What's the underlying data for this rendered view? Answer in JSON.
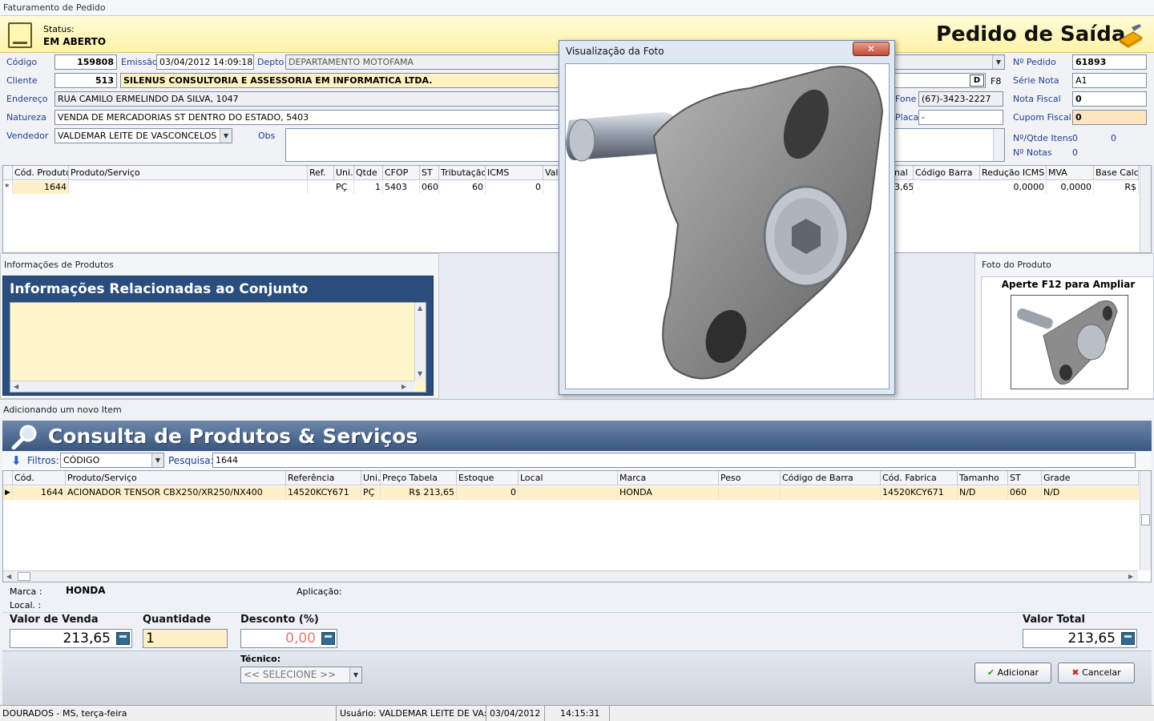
{
  "window": {
    "title": "Faturamento de Pedido"
  },
  "header": {
    "status_label": "Status:",
    "status_value": "EM ABERTO",
    "title": "Pedido de Saída"
  },
  "form": {
    "codigo_label": "Código",
    "codigo": "159808",
    "emissao_label": "Emissão",
    "emissao": "03/04/2012 14:09:18",
    "depto_label": "Depto",
    "depto": "DEPARTAMENTO MOTOFAMA",
    "cliente_label": "Cliente",
    "cliente_cod": "513",
    "cliente_nome": "SILENUS CONSULTORIA E ASSESSORIA EM INFORMATICA LTDA.",
    "endereco_label": "Endereço",
    "endereco": "RUA CAMILO ERMELINDO DA SILVA, 1047",
    "natureza_label": "Natureza",
    "natureza": "VENDA DE MERCADORIAS ST DENTRO  DO ESTADO, 5403",
    "vendedor_label": "Vendedor",
    "vendedor": "VALDEMAR LEITE DE VASCONCELOS",
    "obs_label": "Obs",
    "d_button": "D",
    "f8_label": "F8",
    "fone_label": "Fone",
    "fone": "(67)-3423-2227",
    "placa_label": "Placa",
    "placa": "-",
    "pedido_label": "Nº Pedido",
    "pedido": "61893",
    "serie_label": "Série Nota",
    "serie": "A1",
    "nota_label": "Nota Fiscal",
    "nota": "0",
    "cupom_label": "Cupom Fiscal",
    "cupom": "0",
    "qtde_label": "Nº/Qtde Itens",
    "qtde_a": "0",
    "qtde_b": "0",
    "notas_label": "Nº Notas",
    "notas": "0"
  },
  "grid1": {
    "headers": [
      "Cód. Produto",
      "Produto/Serviço",
      "Ref.",
      "Uni.",
      "Qtde",
      "CFOP",
      "ST",
      "Tributação",
      "ICMS",
      "Valo",
      "nal",
      "Código Barra",
      "Redução ICMS",
      "MVA",
      "Base Calcu"
    ],
    "row": {
      "marker": "*",
      "cod": "1644",
      "uni": "PÇ",
      "qtde": "1",
      "cfop": "5403",
      "st": "060",
      "trib": "60",
      "icms": "0",
      "nal": "3,65",
      "reducao": "0,0000",
      "mva": "0,0000",
      "base": "R$"
    }
  },
  "info_panel": {
    "title": "Informações de Produtos",
    "header": "Informações Relacionadas ao Conjunto"
  },
  "foto_panel": {
    "title": "Foto do Produto",
    "hint": "Aperte F12 para Ampliar"
  },
  "popup": {
    "title": "Visualização da Foto",
    "close": "✕"
  },
  "consulta": {
    "section_title": "Adicionando um novo Item",
    "title": "Consulta de Produtos & Serviços",
    "filtros_label": "Filtros:",
    "filtro_value": "CÓDIGO",
    "pesquisa_label": "Pesquisa:",
    "pesquisa_value": "1644",
    "headers": [
      "Cód.",
      "Produto/Serviço",
      "Referência",
      "Uni.",
      "Preço Tabela",
      "Estoque",
      "Local",
      "Marca",
      "Peso",
      "Código de Barra",
      "Cód. Fabrica",
      "Tamanho",
      "ST",
      "Grade"
    ],
    "row": {
      "cod": "1644",
      "produto": "ACIONADOR TENSOR CBX250/XR250/NX400",
      "ref": "14520KCY671",
      "uni": "PÇ",
      "preco": "R$ 213,65",
      "estoque": "0",
      "local": "",
      "marca": "HONDA",
      "peso": "",
      "barra": "",
      "fabrica": "14520KCY671",
      "tamanho": "N/D",
      "st": "060",
      "grade": "N/D"
    }
  },
  "details": {
    "marca_label": "Marca :",
    "marca": "HONDA",
    "local_label": "Local. :",
    "aplicacao_label": "Aplicação:"
  },
  "values": {
    "venda_label": "Valor de Venda",
    "venda": "213,65",
    "qtd_label": "Quantidade",
    "qtd": "1",
    "desc_label": "Desconto (%)",
    "desc": "0,00",
    "total_label": "Valor Total",
    "total": "213,65",
    "tecnico_label": "Técnico:",
    "tecnico": "<< SELECIONE >>",
    "add_button": "Adicionar",
    "cancel_button": "Cancelar"
  },
  "statusbar": {
    "location": "DOURADOS - MS, terça-feira",
    "user": "Usuário: VALDEMAR LEITE DE VA:",
    "date": "03/04/2012",
    "time": "14:15:31"
  }
}
